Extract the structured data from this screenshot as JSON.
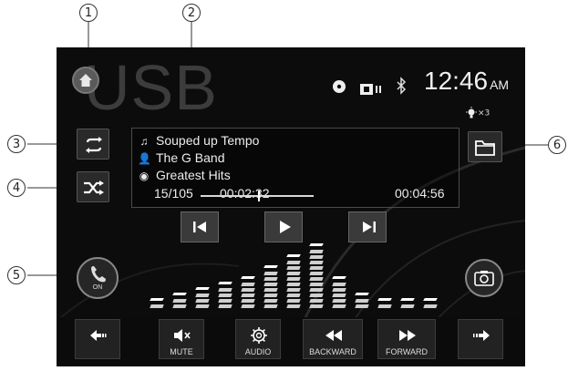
{
  "header": {
    "source_title": "USB",
    "time": "12:46",
    "ampm": "AM",
    "status_icons": [
      "disc-icon",
      "card-icon",
      "bluetooth-icon"
    ],
    "light_indicator": "×3"
  },
  "track": {
    "title": "Souped up Tempo",
    "artist": "The G Band",
    "album": "Greatest Hits",
    "track_position": "15/105",
    "elapsed": "00:02:32",
    "total": "00:04:56",
    "progress": 0.51
  },
  "phone": {
    "state": "ON"
  },
  "equalizer_levels": [
    1,
    2,
    3,
    4,
    5,
    7,
    9,
    11,
    5,
    2,
    1,
    1,
    1
  ],
  "bottom_bar": {
    "back": "",
    "mute": "MUTE",
    "audio": "AUDIO",
    "backward": "BACKWARD",
    "forward": "FORWARD",
    "next": ""
  },
  "callouts": [
    "1",
    "2",
    "3",
    "4",
    "5",
    "6"
  ]
}
